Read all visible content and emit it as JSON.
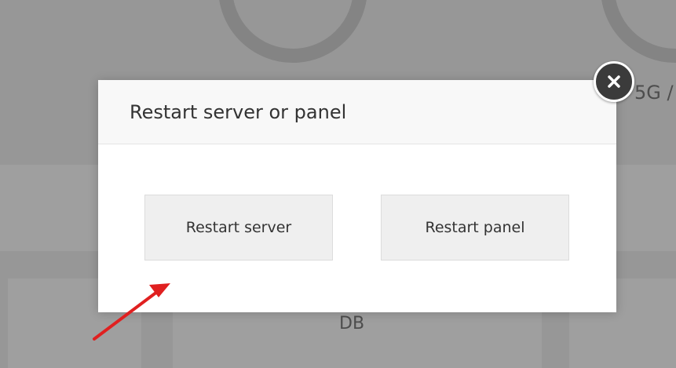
{
  "background": {
    "partial_label": "5G /",
    "db_label": "DB"
  },
  "dialog": {
    "title": "Restart server or panel",
    "buttons": {
      "restart_server": "Restart server",
      "restart_panel": "Restart panel"
    },
    "close_icon": "close-icon"
  },
  "annotation": {
    "arrow_color": "#e02020"
  }
}
